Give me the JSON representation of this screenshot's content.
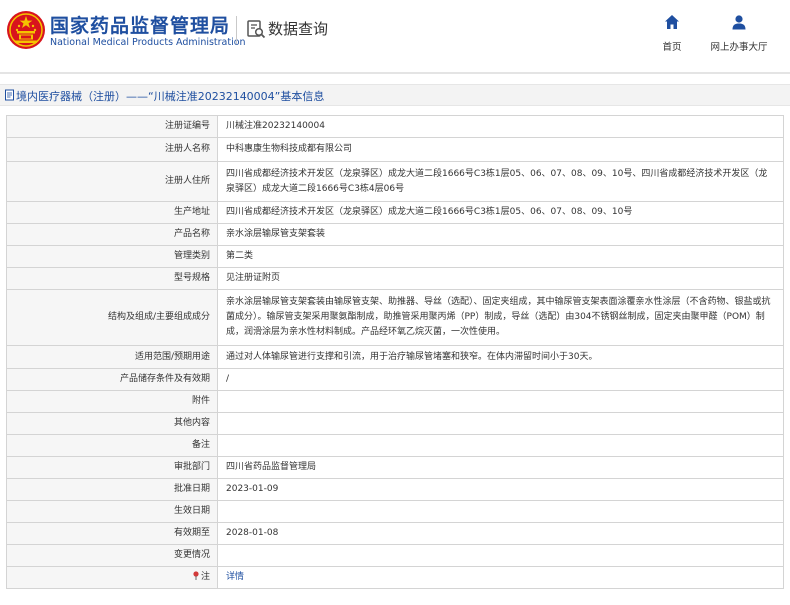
{
  "header": {
    "brand_cn": "国家药品监督管理局",
    "brand_en": "National Medical Products Administration",
    "query_title": "数据查询",
    "nav_home": "首页",
    "nav_hall": "网上办事大厅"
  },
  "page_title": "境内医疗器械（注册）——“川械注准20232140004”基本信息",
  "colors": {
    "brand_blue": "#1f4fa0",
    "emblem_red": "#d8141d",
    "emblem_gold": "#f5c400"
  },
  "fields": [
    {
      "label": "注册证编号",
      "value": "川械注准20232140004"
    },
    {
      "label": "注册人名称",
      "value": "中科惠康生物科技成都有限公司"
    },
    {
      "label": "注册人住所",
      "value": "四川省成都经济技术开发区（龙泉驿区）成龙大道二段1666号C3栋1层05、06、07、08、09、10号、四川省成都经济技术开发区（龙泉驿区）成龙大道二段1666号C3栋4层06号"
    },
    {
      "label": "生产地址",
      "value": "四川省成都经济技术开发区（龙泉驿区）成龙大道二段1666号C3栋1层05、06、07、08、09、10号"
    },
    {
      "label": "产品名称",
      "value": "亲水涂层输尿管支架套装"
    },
    {
      "label": "管理类别",
      "value": "第二类"
    },
    {
      "label": "型号规格",
      "value": "见注册证附页"
    },
    {
      "label": "结构及组成/主要组成成分",
      "value": "亲水涂层输尿管支架套装由输尿管支架、助推器、导丝（选配）、固定夹组成，其中输尿管支架表面涂覆亲水性涂层（不含药物、银盐或抗菌成分）。输尿管支架采用聚氨酯制成，助推管采用聚丙烯（PP）制成，导丝（选配）由304不锈钢丝制成，固定夹由聚甲醛（POM）制成，润滑涂层为亲水性材料制成。产品经环氧乙烷灭菌，一次性使用。"
    },
    {
      "label": "适用范围/预期用途",
      "value": "通过对人体输尿管进行支撑和引流，用于治疗输尿管堵塞和狭窄。在体内滞留时间小于30天。"
    },
    {
      "label": "产品储存条件及有效期",
      "value": "/"
    },
    {
      "label": "附件",
      "value": ""
    },
    {
      "label": "其他内容",
      "value": ""
    },
    {
      "label": "备注",
      "value": ""
    },
    {
      "label": "审批部门",
      "value": "四川省药品监督管理局"
    },
    {
      "label": "批准日期",
      "value": "2023-01-09"
    },
    {
      "label": "生效日期",
      "value": ""
    },
    {
      "label": "有效期至",
      "value": "2028-01-08"
    },
    {
      "label": "变更情况",
      "value": ""
    },
    {
      "label": "注",
      "value": "详情"
    }
  ]
}
